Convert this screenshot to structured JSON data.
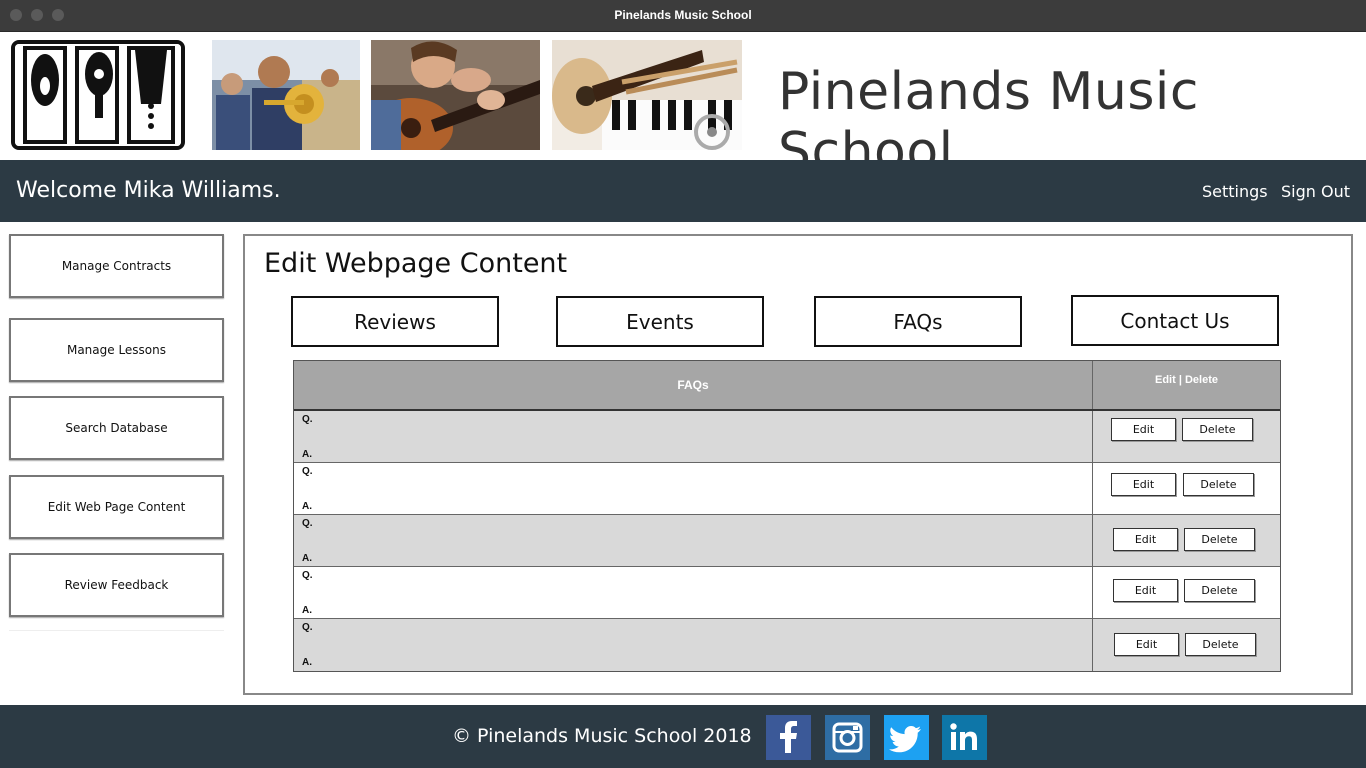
{
  "window": {
    "title": "Pinelands Music School"
  },
  "header": {
    "school_name": "Pinelands Music School"
  },
  "navbar": {
    "welcome": "Welcome Mika Williams.",
    "settings": "Settings",
    "sign_out": "Sign Out"
  },
  "sidebar": {
    "items": [
      {
        "label": "Manage Contracts"
      },
      {
        "label": "Manage Lessons"
      },
      {
        "label": "Search Database"
      },
      {
        "label": "Edit Web Page Content"
      },
      {
        "label": "Review Feedback"
      }
    ]
  },
  "main": {
    "title": "Edit Webpage Content",
    "tabs": [
      {
        "label": "Reviews"
      },
      {
        "label": "Events"
      },
      {
        "label": "FAQs"
      },
      {
        "label": "Contact Us"
      }
    ],
    "table": {
      "col_faqs": "FAQs",
      "col_actions": "Edit | Delete",
      "q_label": "Q.",
      "a_label": "A.",
      "edit_label": "Edit",
      "delete_label": "Delete"
    }
  },
  "footer": {
    "copyright": "© Pinelands Music School   2018"
  },
  "social": [
    {
      "icon": "facebook-icon",
      "glyph": "f",
      "color": "#3b5998"
    },
    {
      "icon": "instagram-icon",
      "glyph": "",
      "color": "#2e6da4"
    },
    {
      "icon": "twitter-icon",
      "glyph": "",
      "color": "#1da1f2"
    },
    {
      "icon": "linkedin-icon",
      "glyph": "in",
      "color": "#0e76a8"
    }
  ]
}
